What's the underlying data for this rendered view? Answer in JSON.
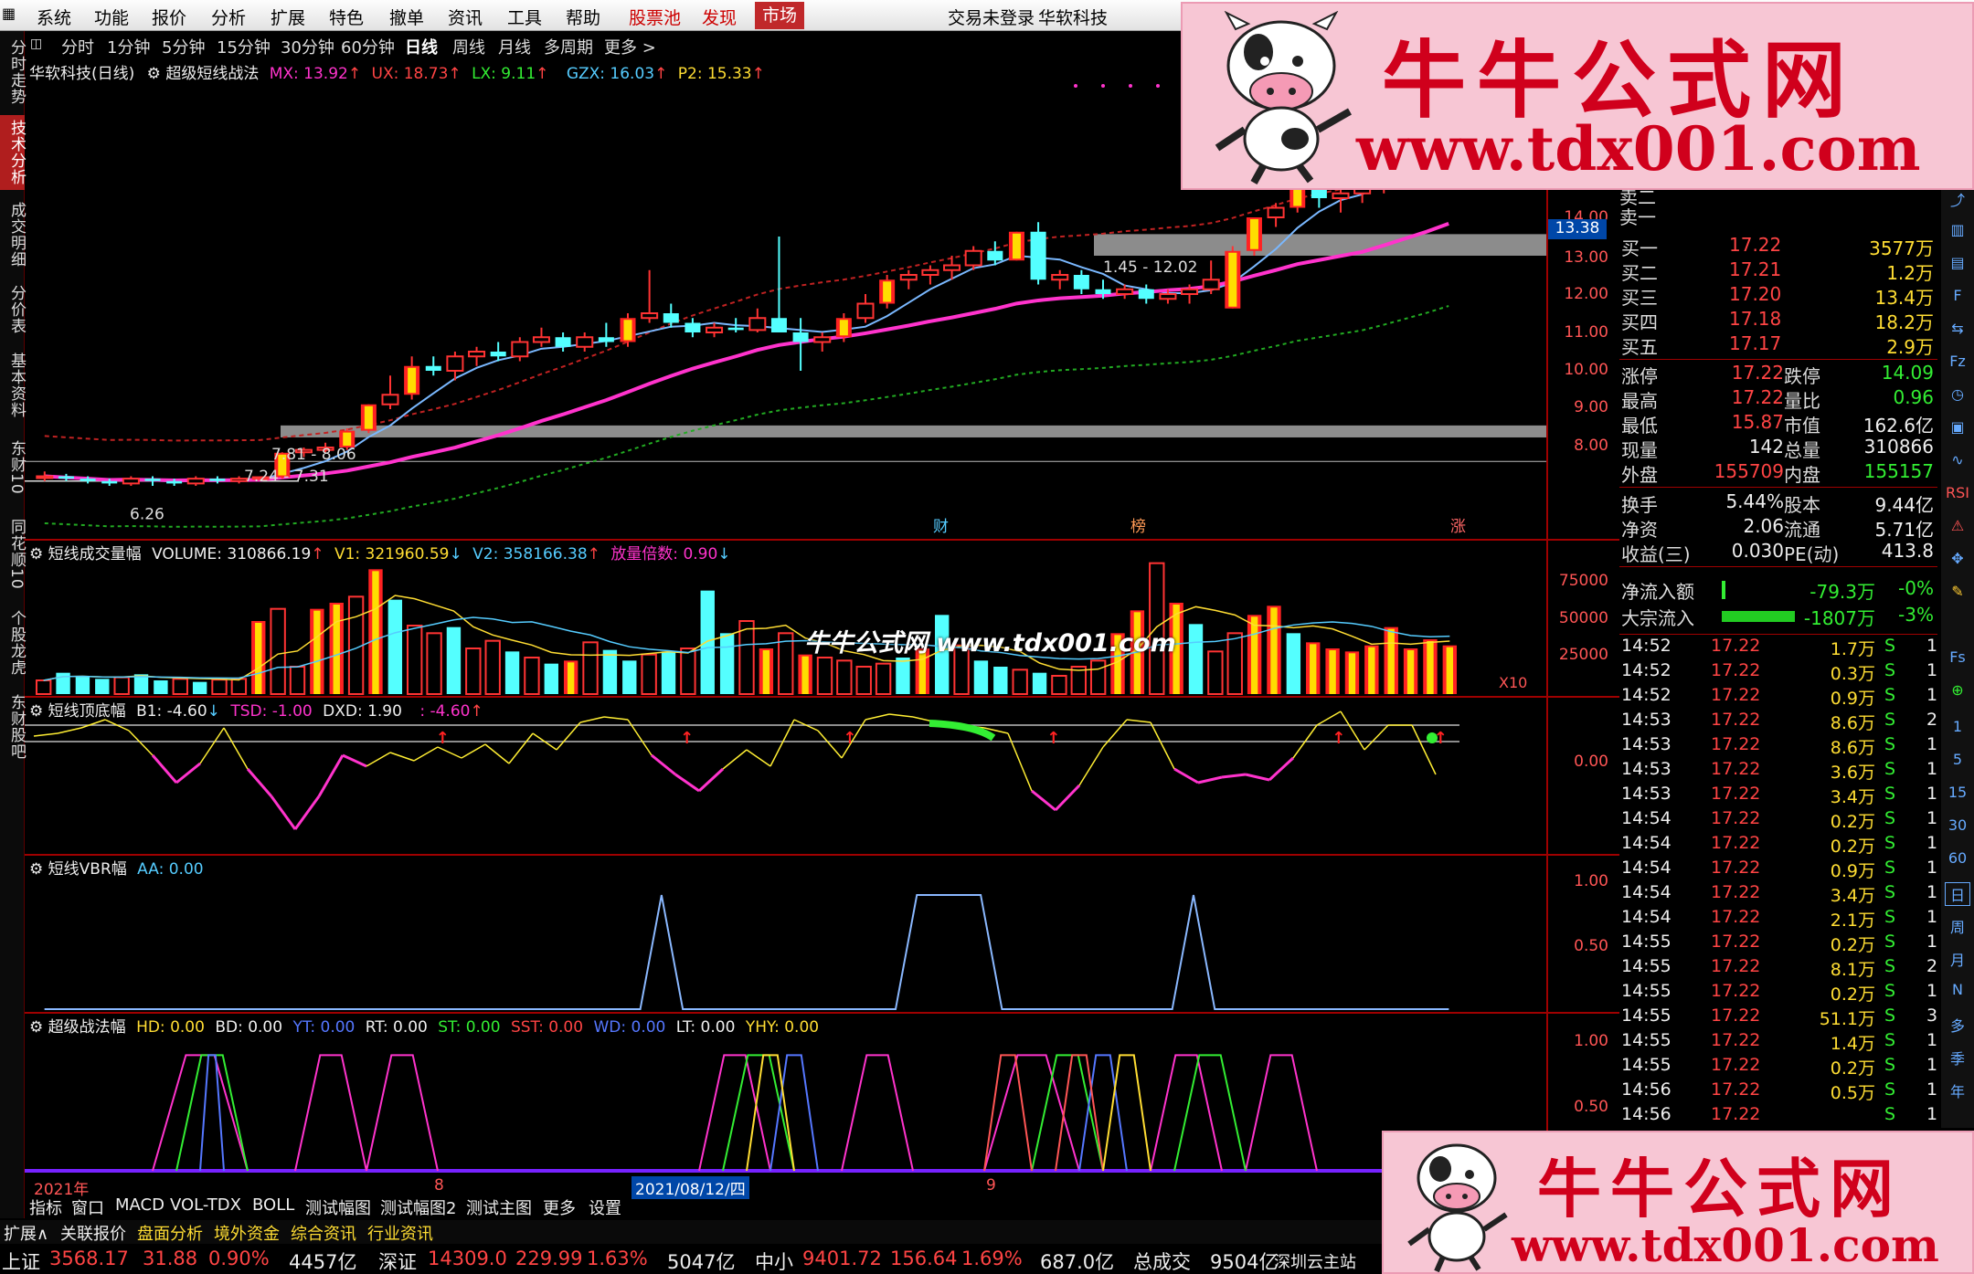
{
  "menu": {
    "items": [
      "系统",
      "功能",
      "报价",
      "分析",
      "扩展",
      "特色",
      "撤单",
      "资讯",
      "工具",
      "帮助"
    ],
    "special": [
      "股票池",
      "发现"
    ],
    "selected": "市场",
    "status": "交易未登录",
    "app": "华软科技"
  },
  "sidebar_tabs": [
    "分时走势",
    "技术分析",
    "成交明细",
    "分价表",
    "基本资料",
    "东财10",
    "同花顺10",
    "个股龙虎",
    "东财股吧"
  ],
  "sidebar_active": 1,
  "periods": [
    "分时",
    "1分钟",
    "5分钟",
    "15分钟",
    "30分钟",
    "60分钟",
    "日线",
    "周线",
    "月线",
    "多周期",
    "更多 >"
  ],
  "period_selected": "日线",
  "main_info": {
    "stock": "华软科技(日线)",
    "indicator": "超级短线战法",
    "mx": "MX: 13.92",
    "ux": "UX: 18.73",
    "lx": "LX: 9.11",
    "gzx": "GZX: 16.03",
    "p2": "P2: 15.33"
  },
  "price_axis": [
    "14.00",
    "13.00",
    "12.00",
    "11.00",
    "10.00",
    "9.00",
    "8.00"
  ],
  "price_marker": "13.38",
  "zone_labels": [
    "1.45 - 12.02",
    "7.81 - 8.06",
    "7.24 - 7.31",
    "6.26"
  ],
  "event_flags": [
    "财",
    "榜",
    "涨"
  ],
  "vol_info": {
    "name": "短线成交量幅",
    "volume": "VOLUME: 310866.19",
    "v1": "V1: 321960.59",
    "v2": "V2: 358166.38",
    "ratio": "放量倍数: 0.90"
  },
  "vol_axis": [
    "75000",
    "50000",
    "25000"
  ],
  "vol_unit": "X10",
  "dd_info": {
    "name": "短线顶底幅",
    "b1": "B1: -4.60",
    "tsd": "TSD: -1.00",
    "dxd": "DXD: 1.90",
    "x": ": -4.60"
  },
  "dd_axis": [
    "0.00"
  ],
  "vbr_info": {
    "name": "短线VBR幅",
    "aa": "AA: 0.00"
  },
  "vbr_axis": [
    "1.00",
    "0.50"
  ],
  "zf_info": {
    "name": "超级战法幅",
    "hd": "HD: 0.00",
    "bd": "BD: 0.00",
    "yt": "YT: 0.00",
    "rt": "RT: 0.00",
    "st": "ST: 0.00",
    "sst": "SST: 0.00",
    "wd": "WD: 0.00",
    "lt": "LT: 0.00",
    "yhy": "YHY: 0.00"
  },
  "zf_axis": [
    "1.00",
    "0.50"
  ],
  "date_axis": [
    "2021年",
    "8",
    "2021/08/12/四",
    "9"
  ],
  "bottom_tabs": [
    "指标",
    "窗口",
    "MACD",
    "VOL-TDX",
    "BOLL",
    "测试幅图",
    "测试幅图2",
    "测试主图",
    "更多",
    "设置"
  ],
  "bottom_tabs2": [
    "扩展∧",
    "关联报价",
    "盘面分析",
    "境外资金",
    "综合资讯",
    "行业资讯"
  ],
  "order_book": [
    {
      "label": "卖二",
      "price": "",
      "vol": ""
    },
    {
      "label": "卖一",
      "price": "",
      "vol": ""
    },
    {
      "label": "买一",
      "price": "17.22",
      "vol": "3577万"
    },
    {
      "label": "买二",
      "price": "17.21",
      "vol": "1.2万"
    },
    {
      "label": "买三",
      "price": "17.20",
      "vol": "13.4万"
    },
    {
      "label": "买四",
      "price": "17.18",
      "vol": "18.2万"
    },
    {
      "label": "买五",
      "price": "17.17",
      "vol": "2.9万"
    }
  ],
  "quote": [
    [
      "涨停",
      "17.22",
      "跌停",
      "14.09"
    ],
    [
      "最高",
      "17.22",
      "量比",
      "0.96"
    ],
    [
      "最低",
      "15.87",
      "市值",
      "162.6亿"
    ],
    [
      "现量",
      "142",
      "总量",
      "310866"
    ],
    [
      "外盘",
      "155709",
      "内盘",
      "155157"
    ],
    [
      "换手",
      "5.44%",
      "股本",
      "9.44亿"
    ],
    [
      "净资",
      "2.06",
      "流通",
      "5.71亿"
    ],
    [
      "收益(三)",
      "0.030",
      "PE(动)",
      "413.8"
    ]
  ],
  "flows": [
    {
      "label": "净流入额",
      "value": "-79.3万",
      "pct": "-0%"
    },
    {
      "label": "大宗流入",
      "value": "-1807万",
      "pct": "-3%"
    }
  ],
  "ticks": [
    [
      "14:52",
      "17.22",
      "1.7万",
      "S",
      "1"
    ],
    [
      "14:52",
      "17.22",
      "0.3万",
      "S",
      "1"
    ],
    [
      "14:52",
      "17.22",
      "0.9万",
      "S",
      "1"
    ],
    [
      "14:53",
      "17.22",
      "8.6万",
      "S",
      "2"
    ],
    [
      "14:53",
      "17.22",
      "8.6万",
      "S",
      "1"
    ],
    [
      "14:53",
      "17.22",
      "3.6万",
      "S",
      "1"
    ],
    [
      "14:53",
      "17.22",
      "3.4万",
      "S",
      "1"
    ],
    [
      "14:54",
      "17.22",
      "0.2万",
      "S",
      "1"
    ],
    [
      "14:54",
      "17.22",
      "0.2万",
      "S",
      "1"
    ],
    [
      "14:54",
      "17.22",
      "0.9万",
      "S",
      "1"
    ],
    [
      "14:54",
      "17.22",
      "3.4万",
      "S",
      "1"
    ],
    [
      "14:54",
      "17.22",
      "2.1万",
      "S",
      "1"
    ],
    [
      "14:55",
      "17.22",
      "0.2万",
      "S",
      "1"
    ],
    [
      "14:55",
      "17.22",
      "8.1万",
      "S",
      "2"
    ],
    [
      "14:55",
      "17.22",
      "0.2万",
      "S",
      "1"
    ],
    [
      "14:55",
      "17.22",
      "51.1万",
      "S",
      "3"
    ],
    [
      "14:55",
      "17.22",
      "1.4万",
      "S",
      "1"
    ],
    [
      "14:55",
      "17.22",
      "0.2万",
      "S",
      "1"
    ],
    [
      "14:56",
      "17.22",
      "0.5万",
      "S",
      "1"
    ],
    [
      "14:56",
      "17.22",
      "",
      "S",
      "1"
    ]
  ],
  "right_tools": [
    "1",
    "5",
    "15",
    "30",
    "60",
    "日",
    "周",
    "月",
    "N",
    "多",
    "季",
    "年"
  ],
  "statusbar": [
    {
      "label": "上证",
      "price": "3568.17",
      "chg": "31.88",
      "pct": "0.90%",
      "amt": "4457亿"
    },
    {
      "label": "深证",
      "price": "14309.0",
      "chg": "229.99",
      "pct": "1.63%",
      "amt": "5047亿"
    },
    {
      "label": "中小",
      "price": "9401.72",
      "chg": "156.64",
      "pct": "1.69%",
      "amt": "687.0亿"
    }
  ],
  "total_label": "总成交",
  "total_value": "9504亿",
  "server": "深圳云主站",
  "ads": {
    "title": "牛牛公式网",
    "url": "www.tdx001.com"
  },
  "watermark": "牛牛公式网 www.tdx001.com",
  "colors": {
    "up": "#ff3333",
    "down": "#54ffff",
    "ma": "#ff33cc",
    "bg": "#000000",
    "accent": "#c0282a"
  },
  "chart_data": [
    {
      "type": "candlestick",
      "title": "华软科技(日线)",
      "ylim": [
        6,
        14
      ],
      "candles": [
        [
          7.0,
          7.1,
          6.9,
          7.0
        ],
        [
          7.0,
          7.05,
          6.9,
          6.95
        ],
        [
          6.95,
          7.0,
          6.85,
          6.9
        ],
        [
          6.9,
          6.95,
          6.8,
          6.85
        ],
        [
          6.85,
          7.0,
          6.8,
          6.95
        ],
        [
          6.95,
          7.0,
          6.8,
          6.9
        ],
        [
          6.9,
          6.95,
          6.8,
          6.85
        ],
        [
          6.85,
          7.0,
          6.8,
          6.95
        ],
        [
          6.95,
          7.0,
          6.85,
          6.9
        ],
        [
          6.9,
          7.0,
          6.85,
          6.95
        ],
        [
          6.95,
          7.0,
          6.9,
          6.98
        ],
        [
          6.98,
          7.5,
          6.95,
          7.49
        ],
        [
          7.5,
          7.6,
          7.4,
          7.55
        ],
        [
          7.55,
          7.7,
          7.5,
          7.6
        ],
        [
          7.6,
          8.0,
          7.55,
          7.95
        ],
        [
          7.95,
          8.5,
          7.9,
          8.5
        ],
        [
          8.5,
          9.1,
          8.4,
          8.7
        ],
        [
          8.7,
          9.5,
          8.6,
          9.3
        ],
        [
          9.3,
          9.5,
          9.1,
          9.2
        ],
        [
          9.2,
          9.6,
          9.0,
          9.5
        ],
        [
          9.5,
          9.7,
          9.3,
          9.6
        ],
        [
          9.6,
          9.8,
          9.4,
          9.5
        ],
        [
          9.5,
          9.9,
          9.4,
          9.8
        ],
        [
          9.8,
          10.1,
          9.7,
          9.9
        ],
        [
          9.9,
          10.0,
          9.6,
          9.7
        ],
        [
          9.7,
          10.0,
          9.6,
          9.9
        ],
        [
          9.9,
          10.2,
          9.7,
          9.8
        ],
        [
          9.8,
          10.4,
          9.7,
          10.3
        ],
        [
          10.3,
          11.3,
          10.2,
          10.4
        ],
        [
          10.4,
          10.6,
          10.1,
          10.2
        ],
        [
          10.2,
          10.3,
          9.9,
          10.0
        ],
        [
          10.0,
          10.2,
          9.9,
          10.1
        ],
        [
          10.1,
          10.3,
          10.0,
          10.05
        ],
        [
          10.05,
          10.5,
          10.0,
          10.3
        ],
        [
          10.3,
          12.0,
          10.2,
          10.0
        ],
        [
          10.0,
          10.3,
          9.2,
          9.8
        ],
        [
          9.8,
          10.0,
          9.6,
          9.9
        ],
        [
          9.9,
          10.4,
          9.8,
          10.3
        ],
        [
          10.3,
          10.8,
          10.2,
          10.6
        ],
        [
          10.6,
          11.2,
          10.5,
          11.1
        ],
        [
          11.1,
          11.3,
          10.9,
          11.2
        ],
        [
          11.2,
          11.4,
          11.0,
          11.3
        ],
        [
          11.3,
          11.6,
          11.1,
          11.4
        ],
        [
          11.4,
          11.8,
          11.3,
          11.7
        ],
        [
          11.7,
          11.9,
          11.4,
          11.5
        ],
        [
          11.5,
          12.1,
          11.5,
          12.1
        ],
        [
          12.1,
          12.3,
          11.0,
          11.1
        ],
        [
          11.1,
          11.3,
          10.9,
          11.2
        ],
        [
          11.2,
          11.3,
          10.8,
          10.9
        ],
        [
          10.9,
          11.1,
          10.7,
          10.8
        ],
        [
          10.8,
          11.0,
          10.7,
          10.9
        ],
        [
          10.9,
          11.0,
          10.6,
          10.7
        ],
        [
          10.7,
          10.9,
          10.6,
          10.8
        ],
        [
          10.8,
          11.0,
          10.6,
          10.9
        ],
        [
          10.9,
          11.5,
          10.8,
          11.1
        ],
        [
          10.5,
          11.8,
          10.5,
          11.7
        ],
        [
          11.7,
          12.4,
          11.6,
          12.4
        ],
        [
          12.4,
          12.7,
          12.2,
          12.6
        ],
        [
          12.6,
          13.2,
          12.5,
          13.1
        ],
        [
          13.1,
          13.3,
          12.6,
          12.8
        ],
        [
          12.8,
          13.3,
          12.5,
          12.9
        ],
        [
          12.9,
          13.1,
          12.7,
          13.0
        ],
        [
          13.0,
          14.2,
          12.9,
          14.1
        ],
        [
          14.1,
          14.9,
          14.0,
          14.6
        ],
        [
          14.6,
          15.0,
          14.3,
          14.4
        ],
        [
          14.4,
          15.9,
          14.3,
          15.4
        ]
      ]
    },
    {
      "type": "bar",
      "title": "短线成交量幅",
      "ylim": [
        0,
        90000
      ],
      "values": [
        9000,
        14000,
        12000,
        10000,
        11000,
        13000,
        9000,
        10000,
        8000,
        9500,
        10000,
        48000,
        56000,
        18000,
        56000,
        60000,
        64000,
        82000,
        62000,
        45000,
        40000,
        44000,
        30000,
        35000,
        28000,
        24000,
        20000,
        22000,
        34000,
        29000,
        22000,
        26000,
        28000,
        30000,
        68000,
        40000,
        48000,
        30000,
        40000,
        26000,
        24000,
        22000,
        18000,
        20000,
        24000,
        30000,
        52000,
        32000,
        22000,
        18000,
        16000,
        14000,
        12000,
        18000,
        22000,
        40000,
        55000,
        86000,
        60000,
        46000,
        28000,
        40000,
        52000,
        58000,
        40000,
        34000,
        30000,
        28000,
        32000,
        44000,
        30000,
        36000,
        32000
      ]
    },
    {
      "type": "line",
      "title": "短线顶底幅",
      "ylim": [
        -4,
        1
      ],
      "values": [
        0.2,
        0.3,
        0.5,
        0.8,
        0.4,
        -0.5,
        -1.5,
        -0.8,
        0.5,
        -1.0,
        -2.0,
        -3.2,
        -2.0,
        -0.5,
        -0.9,
        -0.4,
        -0.7,
        -0.2,
        -0.6,
        -0.1,
        -0.8,
        0.3,
        -0.3,
        0.7,
        0.9,
        0.8,
        -0.5,
        -1.2,
        -1.8,
        -1.0,
        -0.3,
        -0.9,
        0.8,
        0.4,
        -0.6,
        0.8,
        1.0,
        0.9,
        0.7,
        0.6,
        0.5,
        0.3,
        -1.8,
        -2.5,
        -1.6,
        -0.2,
        0.8,
        0.7,
        -1.0,
        -1.5,
        -1.3,
        -1.2,
        -1.4,
        -0.6,
        0.6,
        1.1,
        -0.3,
        0.6,
        0.6,
        -1.2
      ],
      "signals": [
        20,
        32,
        40,
        50,
        64,
        69
      ]
    },
    {
      "type": "line",
      "title": "短线VBR幅",
      "ylim": [
        0,
        1.2
      ],
      "values": [
        0,
        0,
        0,
        0,
        0,
        0,
        0,
        0,
        0,
        0,
        0,
        0,
        0,
        0,
        0,
        0,
        0,
        0,
        0,
        0,
        0,
        0,
        0,
        0,
        0,
        0,
        0,
        0,
        0,
        1,
        0,
        0,
        0,
        0,
        0,
        0,
        0,
        0,
        0,
        0,
        0,
        1,
        1,
        1,
        1,
        0,
        0,
        0,
        0,
        0,
        0,
        0,
        0,
        0,
        1,
        0,
        0,
        0,
        0,
        0,
        0,
        0,
        0,
        0,
        0,
        0,
        0
      ]
    },
    {
      "type": "line",
      "title": "超级战法幅",
      "ylim": [
        0,
        1.2
      ],
      "series": [
        {
          "name": "HD",
          "color": "#ff33cc",
          "pulses": [
            [
              5,
              9
            ],
            [
              11,
              14
            ],
            [
              14,
              17
            ],
            [
              28,
              31
            ],
            [
              34,
              37
            ],
            [
              40,
              44
            ],
            [
              47,
              50
            ],
            [
              51,
              54
            ]
          ]
        },
        {
          "name": "BD",
          "color": "#33ee33",
          "pulses": [
            [
              6,
              9
            ],
            [
              29,
              32
            ],
            [
              42,
              45
            ],
            [
              48,
              51
            ]
          ]
        },
        {
          "name": "YT",
          "color": "#5577ff",
          "pulses": [
            [
              7,
              8
            ],
            [
              31,
              33
            ],
            [
              44,
              46
            ]
          ]
        },
        {
          "name": "RT",
          "color": "#ff5555",
          "pulses": [
            [
              40,
              42
            ],
            [
              43,
              45
            ]
          ]
        },
        {
          "name": "ST",
          "color": "#ffdd33",
          "pulses": [
            [
              30,
              32
            ],
            [
              45,
              47
            ]
          ]
        }
      ]
    }
  ]
}
